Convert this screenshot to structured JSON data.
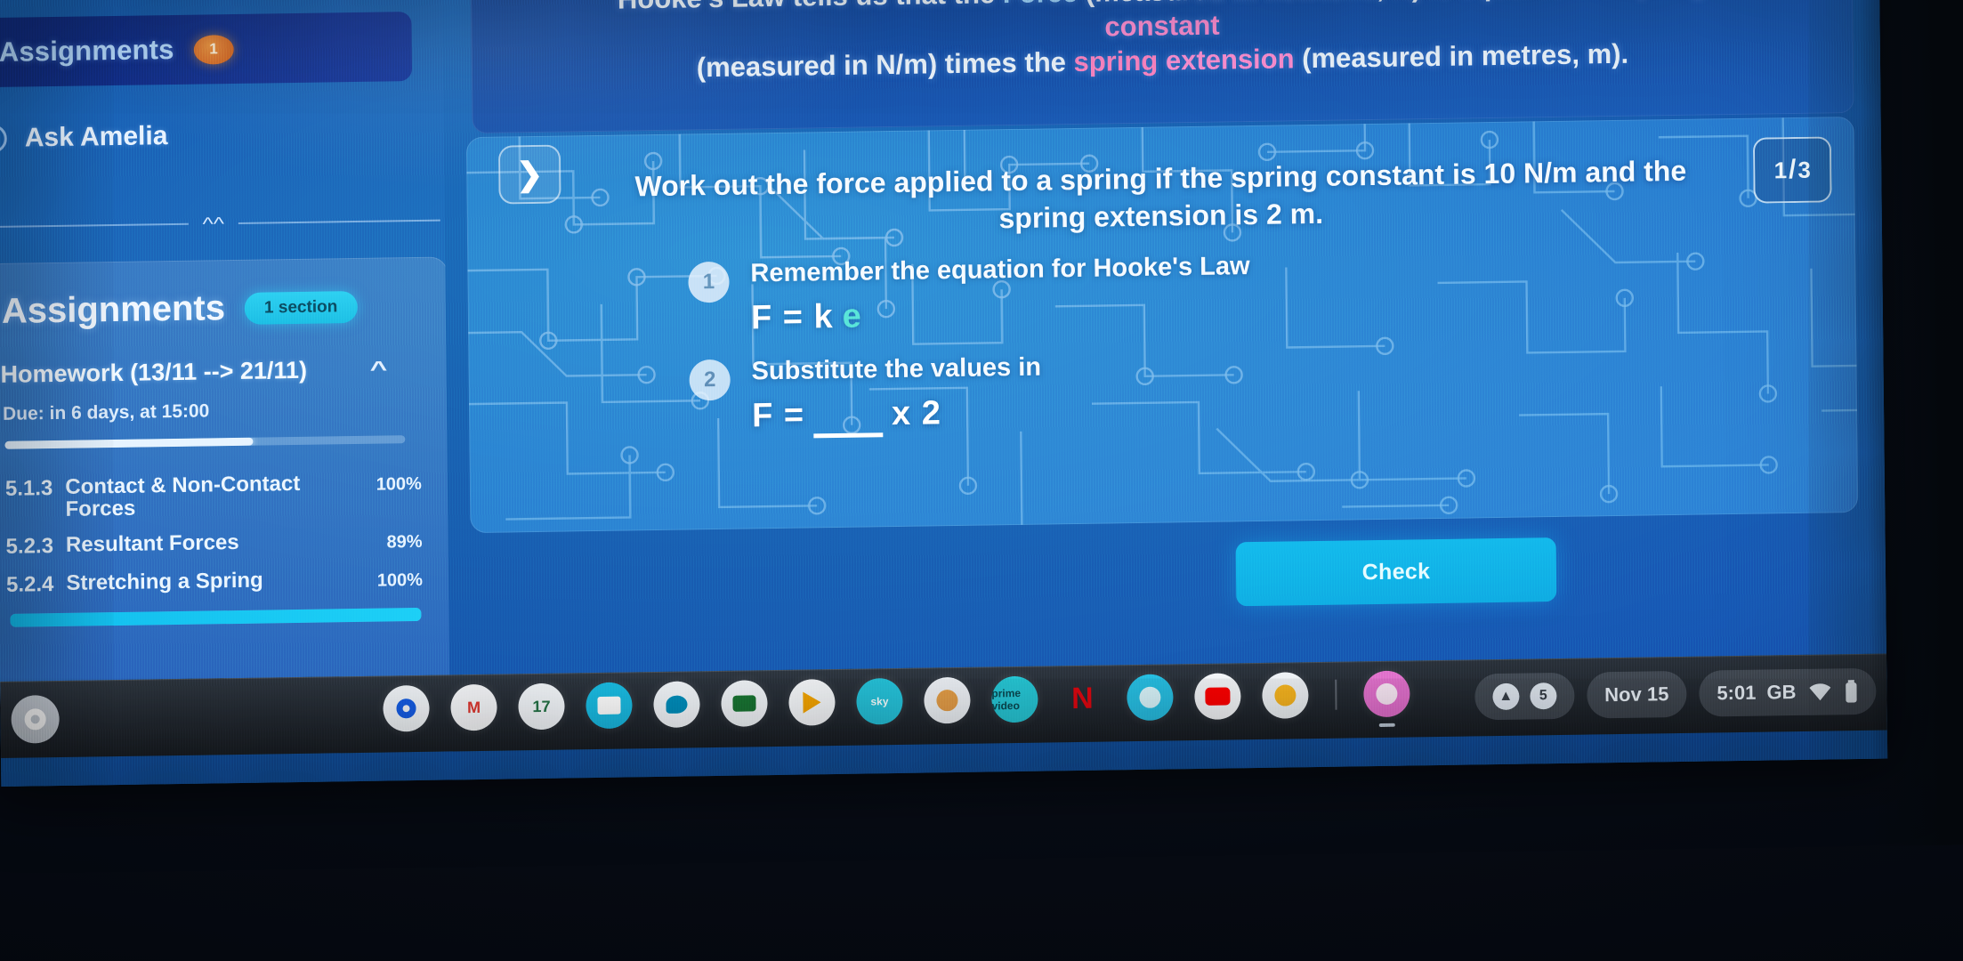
{
  "sidebar": {
    "nav": {
      "assignments_label": "Assignments",
      "assignments_badge": "1",
      "ask_label": "Ask Amelia",
      "collapse_icon": "double-chevron-up-icon"
    },
    "card": {
      "title": "Assignments",
      "section_chip": "1 section",
      "homework_title": "Homework (13/11 --> 21/11)",
      "homework_caret": "^",
      "due_text": "Due: in 6 days, at 15:00",
      "homework_progress_pct": 62,
      "bottom_progress_pct": 100,
      "topics": [
        {
          "code": "5.1.3",
          "name": "Contact & Non-Contact Forces",
          "pct": "100%"
        },
        {
          "code": "5.2.3",
          "name": "Resultant Forces",
          "pct": "89%"
        },
        {
          "code": "5.2.4",
          "name": "Stretching a Spring",
          "pct": "100%"
        }
      ]
    }
  },
  "main": {
    "banner": {
      "line1_a": "Hooke's Law tells us that the ",
      "line1_force": "Force",
      "line1_b": " (measured in newtons, N) is equal to the ",
      "line1_spring_constant": "spring constant",
      "line2_a": "(measured in N/m) times the ",
      "line2_spring": "spring",
      "line2_b": " ",
      "line2_extension": "extension",
      "line2_c": " (measured in metres, m)."
    },
    "question": {
      "nav_icon": "chevron-right-icon",
      "page_current": "1",
      "page_separator": "/",
      "page_total": "3",
      "text": "Work out the force applied to a spring if the spring constant is 10 N/m and the spring extension is 2 m.",
      "steps": [
        {
          "num": "1",
          "title": "Remember the equation for Hooke's Law",
          "eq_prefix": "F = k",
          "eq_highlight": "e"
        },
        {
          "num": "2",
          "title": "Substitute the values in",
          "eq_prefix": "F =",
          "eq_answer_value": "",
          "eq_suffix": "x 2"
        }
      ]
    },
    "check_button": "Check"
  },
  "shelf": {
    "launcher_icon": "launcher-circle-icon",
    "apps": [
      {
        "name": "chrome",
        "glyph": "",
        "bg": "#f3f6f9",
        "fg": "#1a73e8"
      },
      {
        "name": "gmail",
        "glyph": "M",
        "bg": "#f6f7f9",
        "fg": "#e2453c"
      },
      {
        "name": "calendar",
        "glyph": "17",
        "bg": "#f4f7fa",
        "fg": "#2e8b57"
      },
      {
        "name": "files",
        "glyph": "",
        "bg": "#1fc8e8",
        "fg": "#ffffff"
      },
      {
        "name": "chat",
        "glyph": "",
        "bg": "#f4f7fa",
        "fg": "#00a2c7"
      },
      {
        "name": "meet",
        "glyph": "",
        "bg": "#f4f7fa",
        "fg": "#1e8e3e"
      },
      {
        "name": "play-store",
        "glyph": "",
        "bg": "#f6f8fa",
        "fg": "#f5b400"
      },
      {
        "name": "sky",
        "glyph": "sky",
        "bg": "#2ecde0",
        "fg": "#ffffff"
      },
      {
        "name": "photos-app",
        "glyph": "",
        "bg": "#f1f4f8",
        "fg": "#e8a33d"
      },
      {
        "name": "prime-video",
        "glyph": "prime video",
        "bg": "#2fd0dc",
        "fg": "#0c5c66"
      },
      {
        "name": "netflix",
        "glyph": "N",
        "bg": "transparent",
        "fg": "#e50914"
      },
      {
        "name": "nordvpn",
        "glyph": "",
        "bg": "#31cbe8",
        "fg": "#ffffff"
      },
      {
        "name": "youtube",
        "glyph": "",
        "bg": "#f6f8fa",
        "fg": "#ff0000"
      },
      {
        "name": "google-photos",
        "glyph": "",
        "bg": "#f2f5f8",
        "fg": "#fbbc04"
      },
      {
        "name": "active-window",
        "glyph": "",
        "bg": "#e98fd8",
        "fg": "#ffffff"
      }
    ],
    "tray": {
      "up_icon": "caret-up-icon",
      "notif_count": "5",
      "date": "Nov 15",
      "time": "5:01",
      "locale": "GB",
      "wifi_icon": "wifi-icon",
      "battery_icon": "battery-icon"
    }
  }
}
